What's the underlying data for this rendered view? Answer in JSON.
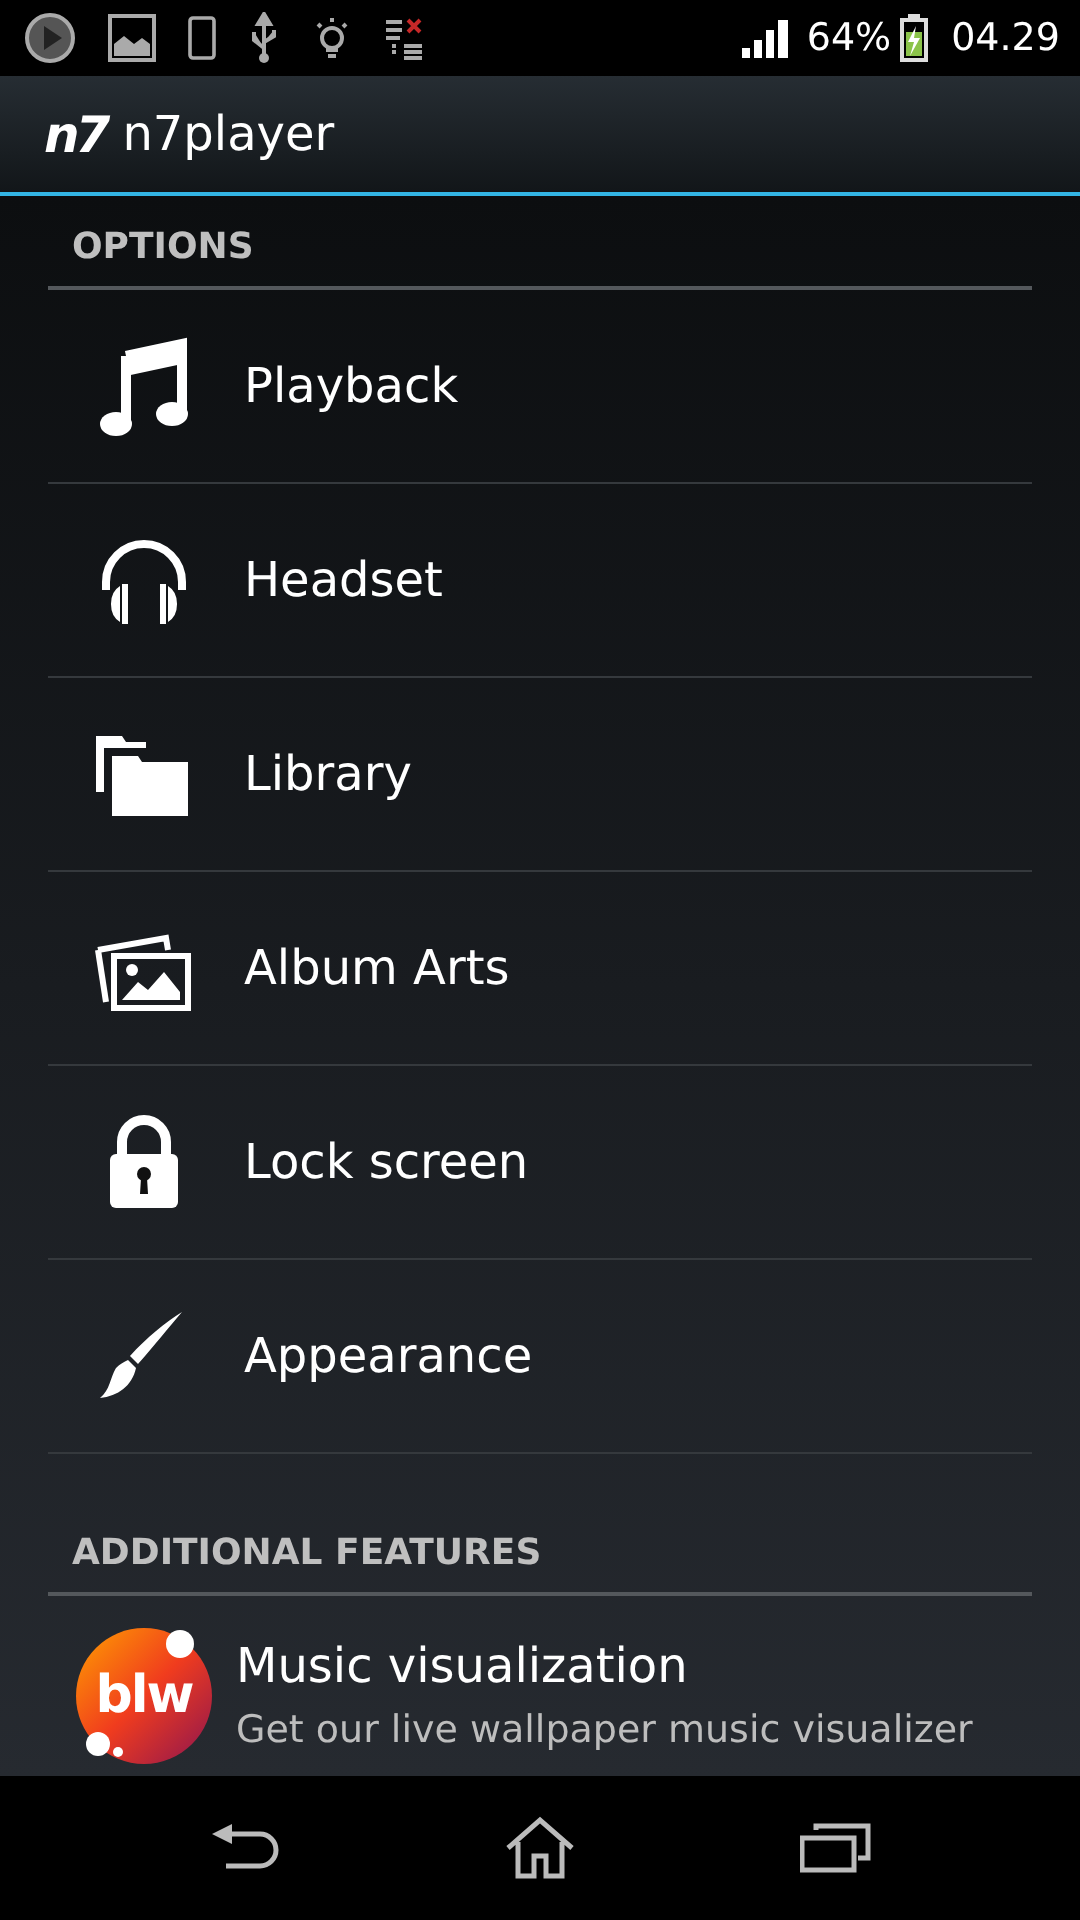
{
  "status_bar": {
    "battery": "64%",
    "time": "04.29"
  },
  "app_bar": {
    "logo": "n7",
    "title": "n7player"
  },
  "sections": [
    {
      "header": "OPTIONS",
      "items": [
        {
          "kind": "icon",
          "title": "Playback"
        },
        {
          "kind": "icon",
          "title": "Headset"
        },
        {
          "kind": "icon",
          "title": "Library"
        },
        {
          "kind": "icon",
          "title": "Album Arts"
        },
        {
          "kind": "icon",
          "title": "Lock screen"
        },
        {
          "kind": "icon",
          "title": "Appearance"
        }
      ]
    },
    {
      "header": "ADDITIONAL FEATURES",
      "items": [
        {
          "kind": "promo",
          "badge": "blw",
          "title": "Music visualization",
          "subtitle": "Get our live wallpaper music visualizer"
        }
      ]
    }
  ]
}
